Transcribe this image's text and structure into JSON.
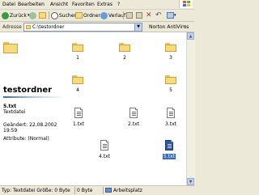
{
  "menu": [
    "Datei",
    "Bearbeiten",
    "Ansicht",
    "Favoriten",
    "Extras",
    "?"
  ],
  "toolbar": {
    "back_label": "Zurück",
    "search_label": "Suchen",
    "folders_label": "Ordner",
    "history_label": "Verlauf"
  },
  "address": {
    "label": "Adresse",
    "value": "C:\\testordner",
    "norton_label": "Norton AntiVirus",
    "chevron": "»"
  },
  "left_panel": {
    "folder_title": "testordner",
    "selected_file": "5.txt",
    "file_type": "Textdatei",
    "modified": "Geändert: 22.08.2002 19:59",
    "attributes": "Attribute: (Normal)"
  },
  "items": [
    {
      "name": "1",
      "kind": "folder"
    },
    {
      "name": "2",
      "kind": "folder"
    },
    {
      "name": "3",
      "kind": "folder"
    },
    {
      "name": "4",
      "kind": "folder"
    },
    {
      "name": "5",
      "kind": "folder"
    },
    {
      "name": "1.txt",
      "kind": "txt"
    },
    {
      "name": "2.txt",
      "kind": "txt"
    },
    {
      "name": "3.txt",
      "kind": "txt"
    },
    {
      "name": "4.txt",
      "kind": "txt"
    },
    {
      "name": "5.txt",
      "kind": "txt",
      "selected": true
    }
  ],
  "status": {
    "text": "Typ: Textdatei Größe: 0 Byte",
    "size": "0 Byte",
    "zone": "Arbeitsplatz"
  },
  "colors": {
    "selection": "#316ac5",
    "window_bg": "#ece9d8",
    "folder": "#f6da7e"
  }
}
